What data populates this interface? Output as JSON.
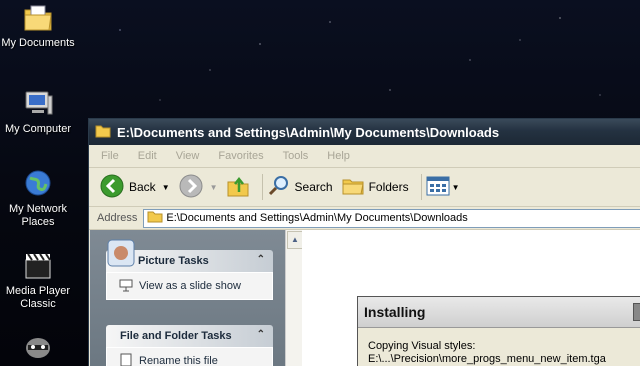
{
  "desktop": {
    "icons": [
      {
        "label": "My Documents",
        "icon": "folder-documents-icon"
      },
      {
        "label": "My Computer",
        "icon": "computer-icon"
      },
      {
        "label": "My Network Places",
        "icon": "globe-icon"
      },
      {
        "label": "Media Player Classic",
        "icon": "clapperboard-icon"
      },
      {
        "label": "",
        "icon": "raccoon-icon"
      }
    ]
  },
  "window": {
    "title": "E:\\Documents and Settings\\Admin\\My Documents\\Downloads",
    "menu": [
      "File",
      "Edit",
      "View",
      "Favorites",
      "Tools",
      "Help"
    ],
    "toolbar": {
      "back": "Back",
      "search": "Search",
      "folders": "Folders"
    },
    "address": {
      "label": "Address",
      "value": "E:\\Documents and Settings\\Admin\\My Documents\\Downloads"
    },
    "tasks": {
      "picture_title": "Picture Tasks",
      "picture_item": "View as a slide show",
      "file_title": "File and Folder Tasks",
      "file_item": "Rename this file"
    }
  },
  "dialog": {
    "title": "Installing",
    "line1": "Copying Visual styles:",
    "line2": "E:\\...\\Precision\\more_progs_menu_new_item.tga"
  },
  "colors": {
    "accent": "#243241",
    "folder": "#f2c94c",
    "back_green": "#3c9b2e"
  }
}
